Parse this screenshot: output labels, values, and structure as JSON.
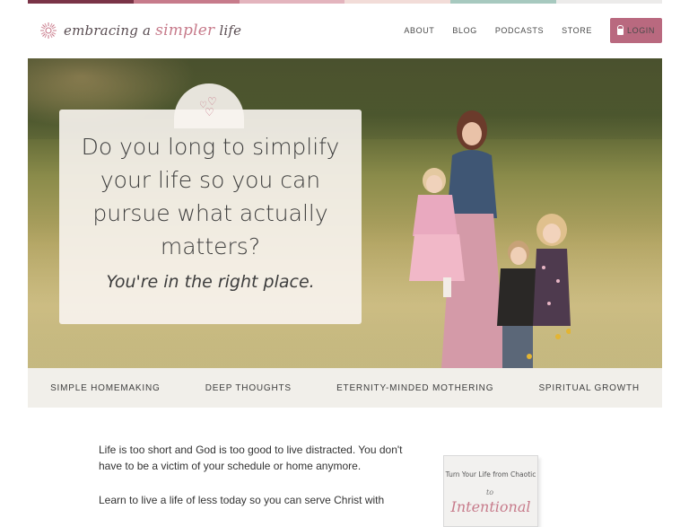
{
  "colors": {
    "accent": "#b9697f",
    "stripe": [
      "#7a3447",
      "#c77b8b",
      "#e3b4bd",
      "#f2dcd8",
      "#a7c9bf",
      "#ecebea"
    ]
  },
  "header": {
    "logo": {
      "part1": "embracing a",
      "part2": "simpler",
      "part3": "life",
      "icon": "flower-icon"
    },
    "nav": [
      "ABOUT",
      "BLOG",
      "PODCASTS",
      "STORE"
    ],
    "login_label": "LOGIN",
    "login_icon": "lock-icon"
  },
  "hero": {
    "headline": "Do you long to simplify your life so you can pursue what actually matters?",
    "subheadline": "You're in the right place.",
    "icon": "hearts-icon"
  },
  "categories": [
    "SIMPLE HOMEMAKING",
    "DEEP THOUGHTS",
    "ETERNITY-MINDED MOTHERING",
    "SPIRITUAL GROWTH"
  ],
  "intro": {
    "p1": "Life is too short and God is too good to live distracted. You don't have to be a victim of your schedule or home anymore.",
    "p2": "Learn to live a life of less today so you can serve Christ with"
  },
  "book": {
    "line1": "Turn Your Life from Chaotic",
    "to": "to",
    "title": "Intentional"
  }
}
